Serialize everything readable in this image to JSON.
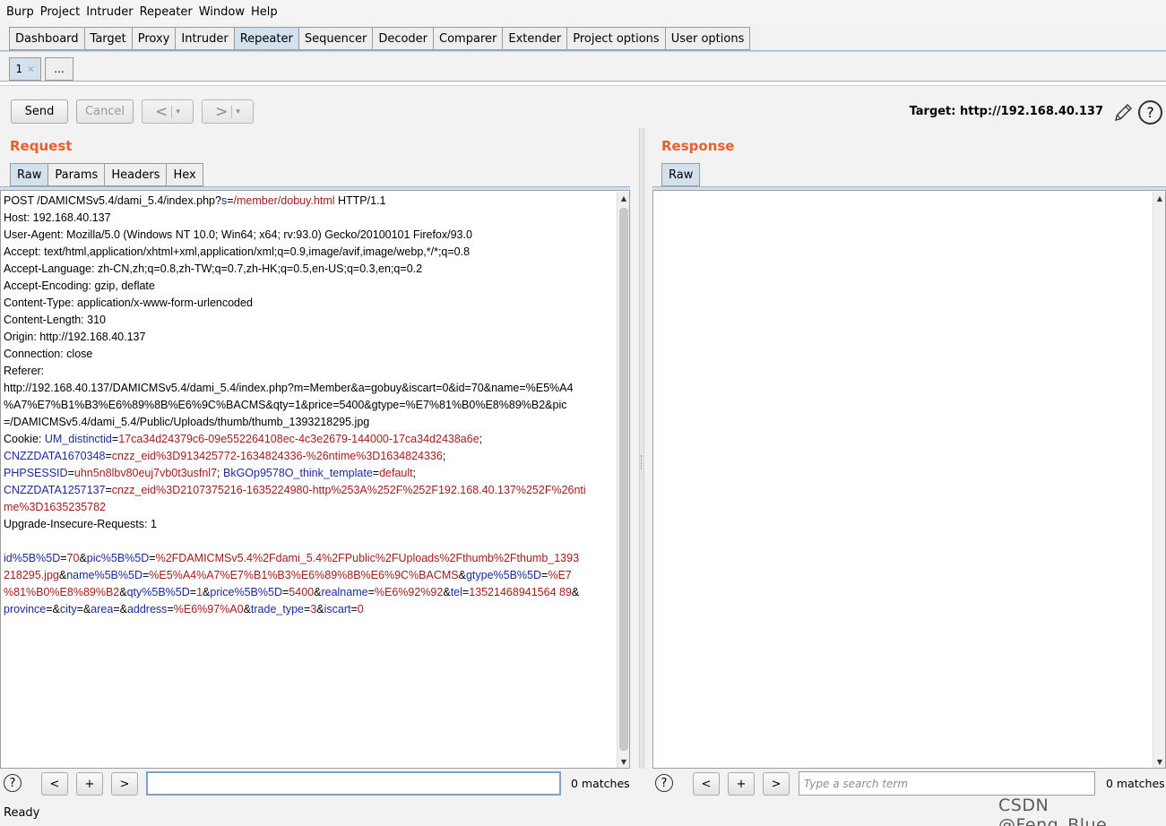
{
  "menu": [
    "Burp",
    "Project",
    "Intruder",
    "Repeater",
    "Window",
    "Help"
  ],
  "main_tabs": [
    {
      "label": "Dashboard",
      "active": false
    },
    {
      "label": "Target",
      "active": false
    },
    {
      "label": "Proxy",
      "active": false
    },
    {
      "label": "Intruder",
      "active": false
    },
    {
      "label": "Repeater",
      "active": true
    },
    {
      "label": "Sequencer",
      "active": false
    },
    {
      "label": "Decoder",
      "active": false
    },
    {
      "label": "Comparer",
      "active": false
    },
    {
      "label": "Extender",
      "active": false
    },
    {
      "label": "Project options",
      "active": false
    },
    {
      "label": "User options",
      "active": false
    }
  ],
  "repeater_tabs": {
    "tab1_label": "1",
    "close_glyph": "×",
    "more_label": "..."
  },
  "toolbar": {
    "send_label": "Send",
    "cancel_label": "Cancel",
    "back_glyph": "<",
    "forward_glyph": ">",
    "dropdown_glyph": "▾"
  },
  "target": {
    "label": "Target: http://192.168.40.137"
  },
  "request": {
    "title": "Request",
    "tabs": [
      "Raw",
      "Params",
      "Headers",
      "Hex"
    ],
    "active_tab": "Raw",
    "lines": [
      [
        {
          "t": "POST /DAMICMSv5.4/dami_5.4/index.php?"
        },
        {
          "t": "s",
          "c": "k"
        },
        {
          "t": "="
        },
        {
          "t": "/member/dobuy.html",
          "c": "v"
        },
        {
          "t": " HTTP/1.1"
        }
      ],
      [
        {
          "t": "Host: 192.168.40.137"
        }
      ],
      [
        {
          "t": "User-Agent: Mozilla/5.0 (Windows NT 10.0; Win64; x64; rv:93.0) Gecko/20100101 Firefox/93.0"
        }
      ],
      [
        {
          "t": "Accept: text/html,application/xhtml+xml,application/xml;q=0.9,image/avif,image/webp,*/*;q=0.8"
        }
      ],
      [
        {
          "t": "Accept-Language: zh-CN,zh;q=0.8,zh-TW;q=0.7,zh-HK;q=0.5,en-US;q=0.3,en;q=0.2"
        }
      ],
      [
        {
          "t": "Accept-Encoding: gzip, deflate"
        }
      ],
      [
        {
          "t": "Content-Type: application/x-www-form-urlencoded"
        }
      ],
      [
        {
          "t": "Content-Length: 310"
        }
      ],
      [
        {
          "t": "Origin: http://192.168.40.137"
        }
      ],
      [
        {
          "t": "Connection: close"
        }
      ],
      [
        {
          "t": "Referer:"
        }
      ],
      [
        {
          "t": "http://192.168.40.137/DAMICMSv5.4/dami_5.4/index.php?m=Member&a=gobuy&iscart=0&id=70&name=%E5%A4"
        }
      ],
      [
        {
          "t": "%A7%E7%B1%B3%E6%89%8B%E6%9C%BACMS&qty=1&price=5400&gtype=%E7%81%B0%E8%89%B2&pic"
        }
      ],
      [
        {
          "t": "=/DAMICMSv5.4/dami_5.4/Public/Uploads/thumb/thumb_1393218295.jpg"
        }
      ],
      [
        {
          "t": "Cookie: "
        },
        {
          "t": "UM_distinctid",
          "c": "k"
        },
        {
          "t": "="
        },
        {
          "t": "17ca34d24379c6-09e552264108ec-4c3e2679-144000-17ca34d2438a6e",
          "c": "v"
        },
        {
          "t": ";"
        }
      ],
      [
        {
          "t": "CNZZDATA1670348",
          "c": "k"
        },
        {
          "t": "="
        },
        {
          "t": "cnzz_eid%3D913425772-1634824336-%26ntime%3D1634824336",
          "c": "v"
        },
        {
          "t": ";"
        }
      ],
      [
        {
          "t": "PHPSESSID",
          "c": "k"
        },
        {
          "t": "="
        },
        {
          "t": "uhn5n8lbv80euj7vb0t3usfnl7",
          "c": "v"
        },
        {
          "t": "; "
        },
        {
          "t": "BkGOp9578O_think_template",
          "c": "k"
        },
        {
          "t": "="
        },
        {
          "t": "default",
          "c": "v"
        },
        {
          "t": ";"
        }
      ],
      [
        {
          "t": "CNZZDATA1257137",
          "c": "k"
        },
        {
          "t": "="
        },
        {
          "t": "cnzz_eid%3D2107375216-1635224980-http%253A%252F%252F192.168.40.137%252F%26nti",
          "c": "v"
        }
      ],
      [
        {
          "t": "me%3D1635235782",
          "c": "v"
        }
      ],
      [
        {
          "t": "Upgrade-Insecure-Requests: 1"
        }
      ],
      [
        {
          "t": ""
        }
      ],
      [
        {
          "t": "id%5B%5D",
          "c": "k"
        },
        {
          "t": "="
        },
        {
          "t": "70",
          "c": "v"
        },
        {
          "t": "&"
        },
        {
          "t": "pic%5B%5D",
          "c": "k"
        },
        {
          "t": "="
        },
        {
          "t": "%2FDAMICMSv5.4%2Fdami_5.4%2FPublic%2FUploads%2Fthumb%2Fthumb_1393",
          "c": "v"
        }
      ],
      [
        {
          "t": "218295.jpg",
          "c": "v"
        },
        {
          "t": "&"
        },
        {
          "t": "name%5B%5D",
          "c": "k"
        },
        {
          "t": "="
        },
        {
          "t": "%E5%A4%A7%E7%B1%B3%E6%89%8B%E6%9C%BACMS",
          "c": "v"
        },
        {
          "t": "&"
        },
        {
          "t": "gtype%5B%5D",
          "c": "k"
        },
        {
          "t": "="
        },
        {
          "t": "%E7",
          "c": "v"
        }
      ],
      [
        {
          "t": "%81%B0%E8%89%B2",
          "c": "v"
        },
        {
          "t": "&"
        },
        {
          "t": "qty%5B%5D",
          "c": "k"
        },
        {
          "t": "="
        },
        {
          "t": "1",
          "c": "v"
        },
        {
          "t": "&"
        },
        {
          "t": "price%5B%5D",
          "c": "k"
        },
        {
          "t": "="
        },
        {
          "t": "5400",
          "c": "v"
        },
        {
          "t": "&"
        },
        {
          "t": "realname",
          "c": "k"
        },
        {
          "t": "="
        },
        {
          "t": "%E6%92%92",
          "c": "v"
        },
        {
          "t": "&"
        },
        {
          "t": "tel",
          "c": "k"
        },
        {
          "t": "="
        },
        {
          "t": "13521468941564 89",
          "c": "v"
        },
        {
          "t": "&"
        }
      ],
      [
        {
          "t": "province",
          "c": "k"
        },
        {
          "t": "=&"
        },
        {
          "t": "city",
          "c": "k"
        },
        {
          "t": "=&"
        },
        {
          "t": "area",
          "c": "k"
        },
        {
          "t": "=&"
        },
        {
          "t": "address",
          "c": "k"
        },
        {
          "t": "="
        },
        {
          "t": "%E6%97%A0",
          "c": "v"
        },
        {
          "t": "&"
        },
        {
          "t": "trade_type",
          "c": "k"
        },
        {
          "t": "="
        },
        {
          "t": "3",
          "c": "v"
        },
        {
          "t": "&"
        },
        {
          "t": "iscart",
          "c": "k"
        },
        {
          "t": "="
        },
        {
          "t": "0",
          "c": "v"
        }
      ]
    ]
  },
  "response": {
    "title": "Response",
    "tabs": [
      "Raw"
    ],
    "active_tab": "Raw"
  },
  "request_search": {
    "help": "?",
    "prev": "<",
    "add": "+",
    "next": ">",
    "value": "",
    "placeholder": "",
    "matches": "0 matches"
  },
  "response_search": {
    "help": "?",
    "prev": "<",
    "add": "+",
    "next": ">",
    "value": "",
    "placeholder": "Type a search term",
    "matches": "0 matches"
  },
  "status": "Ready",
  "watermark": "CSDN @Feng_Blue_",
  "colors": {
    "accent_orange": "#e8602c",
    "active_tab_blue": "#d3e1ee",
    "param_name": "#1c2b9b",
    "param_value": "#a11d1d"
  },
  "icons": [
    "pencil-icon",
    "help-icon"
  ]
}
